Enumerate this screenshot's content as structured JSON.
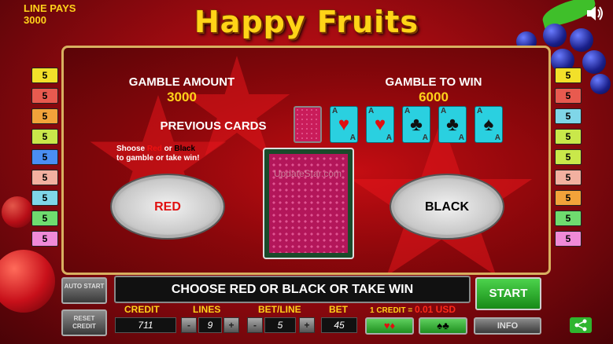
{
  "header": {
    "line_pays_label": "LINE PAYS",
    "line_pays_value": "3000",
    "title": "Happy Fruits"
  },
  "line_badges": {
    "left": [
      "5",
      "5",
      "5",
      "5",
      "5",
      "5",
      "5",
      "5",
      "5"
    ],
    "right": [
      "5",
      "5",
      "5",
      "5",
      "5",
      "5",
      "5",
      "5",
      "5"
    ],
    "left_colors": [
      "#f2e02a",
      "#e85a4f",
      "#f2a33a",
      "#c9e84a",
      "#4a8ef2",
      "#f2b0a0",
      "#7fd6e8",
      "#6fdc6f",
      "#f08ad8"
    ],
    "right_colors": [
      "#f2e02a",
      "#e85a4f",
      "#7fd6e8",
      "#c9e84a",
      "#c9e84a",
      "#f2b0a0",
      "#f2a33a",
      "#6fdc6f",
      "#f08ad8"
    ]
  },
  "gamble": {
    "amount_label": "GAMBLE AMOUNT",
    "amount_value": "3000",
    "to_win_label": "GAMBLE TO WIN",
    "to_win_value": "6000",
    "previous_cards_label": "PREVIOUS CARDS",
    "hint_line1_pre": "Shoose ",
    "hint_red": "Red",
    "hint_or": " or ",
    "hint_black": "Black",
    "hint_line2": "to gamble or take win!",
    "red_button": "RED",
    "black_button": "BLACK",
    "watermark": "UpdateStar.com",
    "previous_cards": [
      {
        "rank": "",
        "suit": "",
        "back": true
      },
      {
        "rank": "A",
        "suit": "♥",
        "color": "#e01010"
      },
      {
        "rank": "A",
        "suit": "♥",
        "color": "#e01010"
      },
      {
        "rank": "A",
        "suit": "♣",
        "color": "#111111"
      },
      {
        "rank": "A",
        "suit": "♣",
        "color": "#111111"
      },
      {
        "rank": "A",
        "suit": "♠",
        "color": "#111111"
      }
    ]
  },
  "controls": {
    "auto_start": "AUTO START",
    "reset_credit": "RESET CREDIT",
    "message": "CHOOSE RED OR BLACK OR TAKE WIN",
    "start": "START",
    "credit_label": "CREDIT",
    "credit_value": "711",
    "lines_label": "LINES",
    "lines_value": "9",
    "betline_label": "BET/LINE",
    "betline_value": "5",
    "bet_label": "BET",
    "bet_value": "45",
    "credit_rate_label": "1 CREDIT =",
    "credit_rate_value": "0.01 USD",
    "info": "INFO",
    "minus": "-",
    "plus": "+",
    "red_suits": "♥♦",
    "black_suits": "♠♣"
  }
}
